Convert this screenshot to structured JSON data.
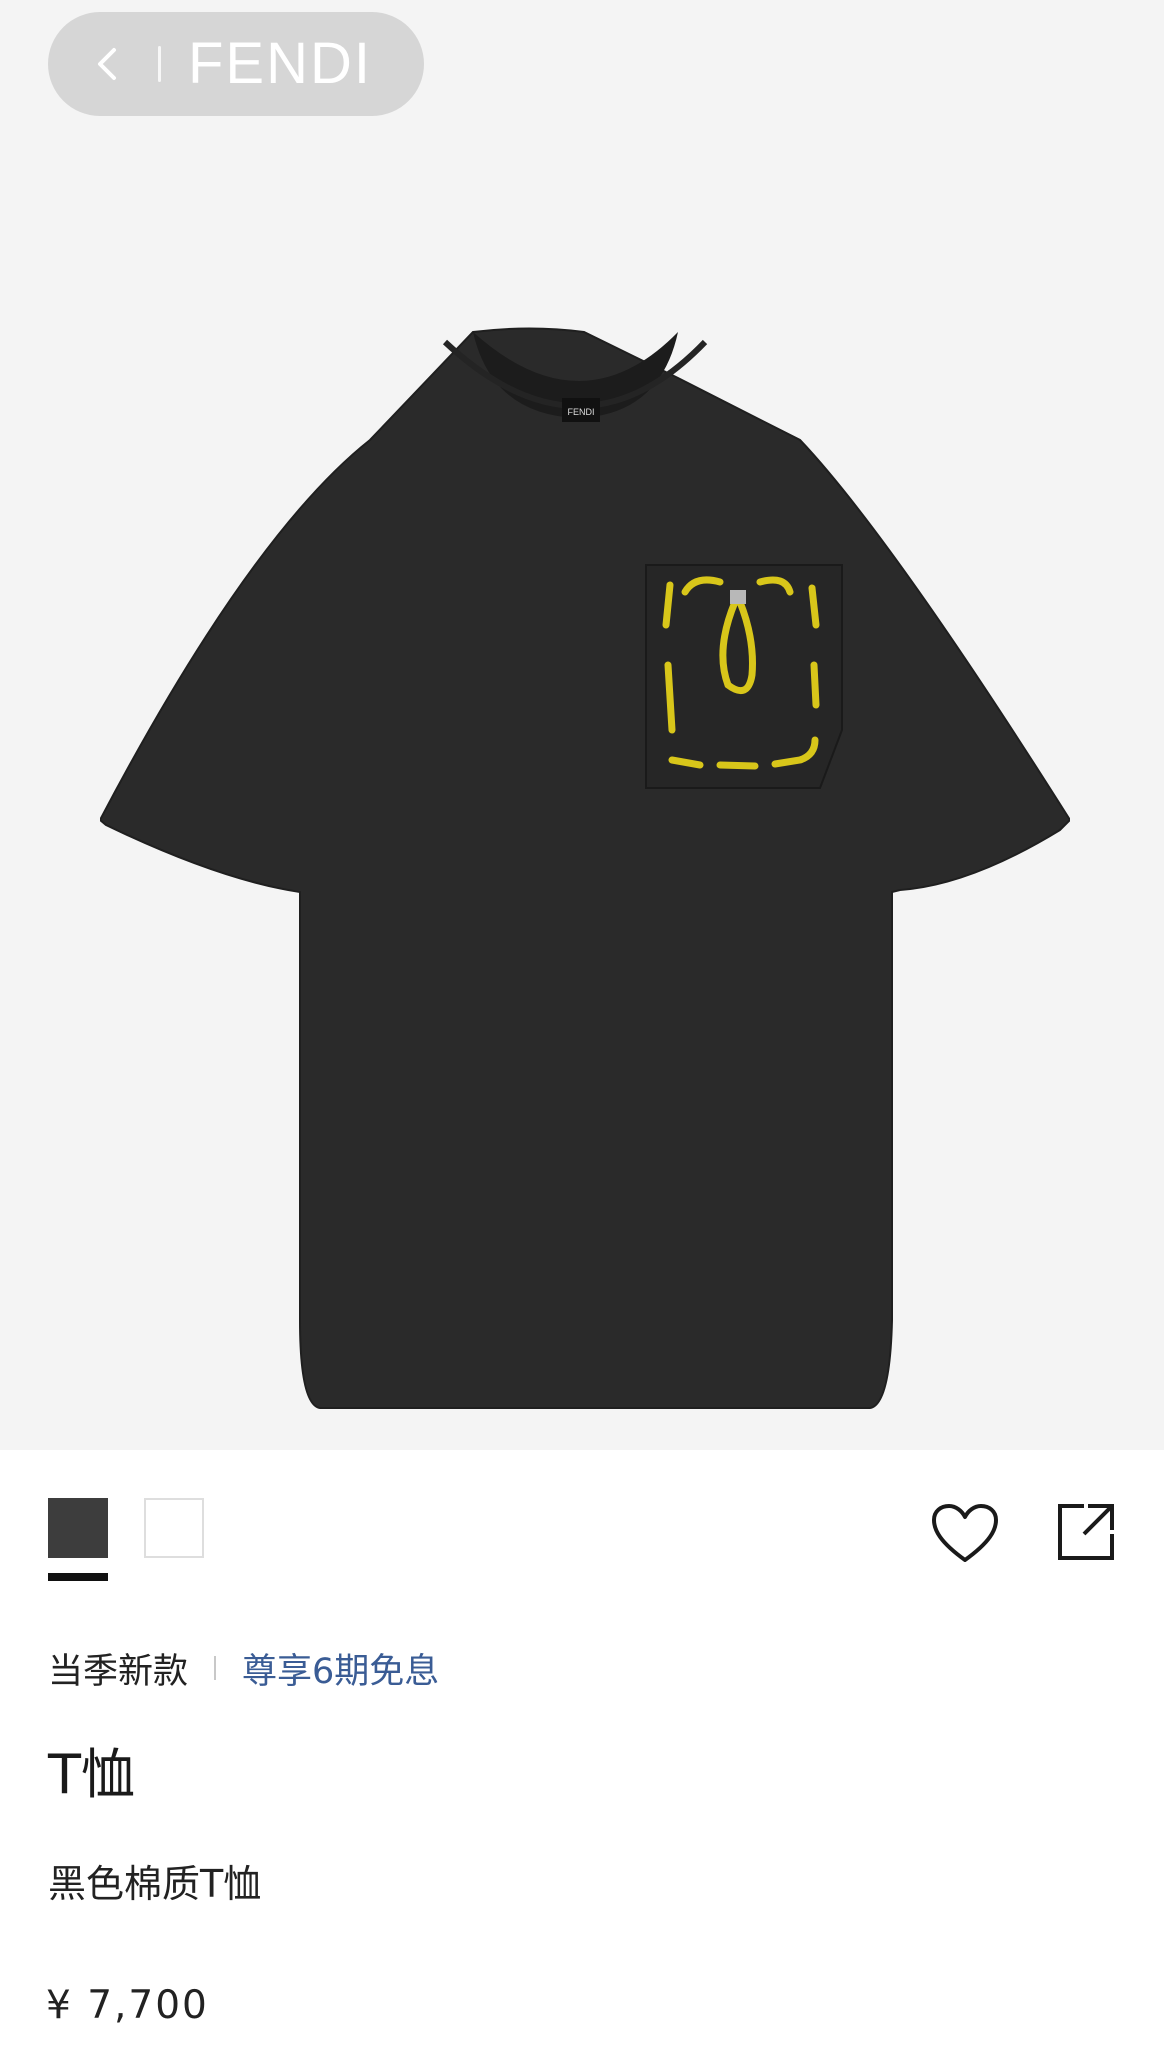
{
  "header": {
    "brand": "FENDI",
    "back_icon": "chevron-left-icon"
  },
  "product_image": {
    "icon": "t-shirt-image",
    "label_text": "FENDI"
  },
  "swatches": [
    {
      "color": "#3d3d3d",
      "selected": true
    },
    {
      "color": "#ffffff",
      "selected": false
    }
  ],
  "actions": {
    "favorite_icon": "heart-icon",
    "share_icon": "share-icon"
  },
  "meta": {
    "tag": "当季新款",
    "promo": "尊享6期免息"
  },
  "product": {
    "title": "T恤",
    "subtitle": "黑色棉质T恤",
    "price": "¥ 7,700"
  }
}
